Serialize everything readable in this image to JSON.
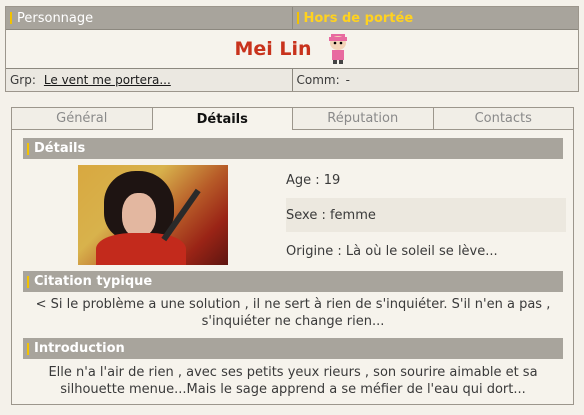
{
  "header": {
    "col1_label": "Personnage",
    "col2_label": "Hors de portée",
    "character_name": "Mei Lin",
    "avatar_icon": "south-park-avatar-icon",
    "group_label": "Grp:",
    "group_value": "Le vent me portera...",
    "comment_label": "Comm:",
    "comment_value": "-"
  },
  "tabs": [
    {
      "label": "Général"
    },
    {
      "label": "Détails"
    },
    {
      "label": "Réputation"
    },
    {
      "label": "Contacts"
    }
  ],
  "active_tab": "Détails",
  "details": {
    "title": "Détails",
    "age": "Age : 19",
    "sexe": "Sexe : femme",
    "origine": "Origine : Là où le soleil se lève..."
  },
  "citation": {
    "title": "Citation typique",
    "line1": "< Si le problème a une solution , il ne sert à rien de s'inquiéter. S'il n'en a pas ,",
    "line2": "s'inquiéter ne change rien..."
  },
  "introduction": {
    "title": "Introduction",
    "line1": "Elle n'a l'air de rien , avec ses petits yeux rieurs , son sourire aimable et sa",
    "line2": "silhouette menue...Mais le sage apprend a se méfier de l'eau qui dort..."
  },
  "colors": {
    "accent_bar": "#f2c200",
    "name_color": "#c8321c",
    "header_bg": "#a8a49c"
  }
}
